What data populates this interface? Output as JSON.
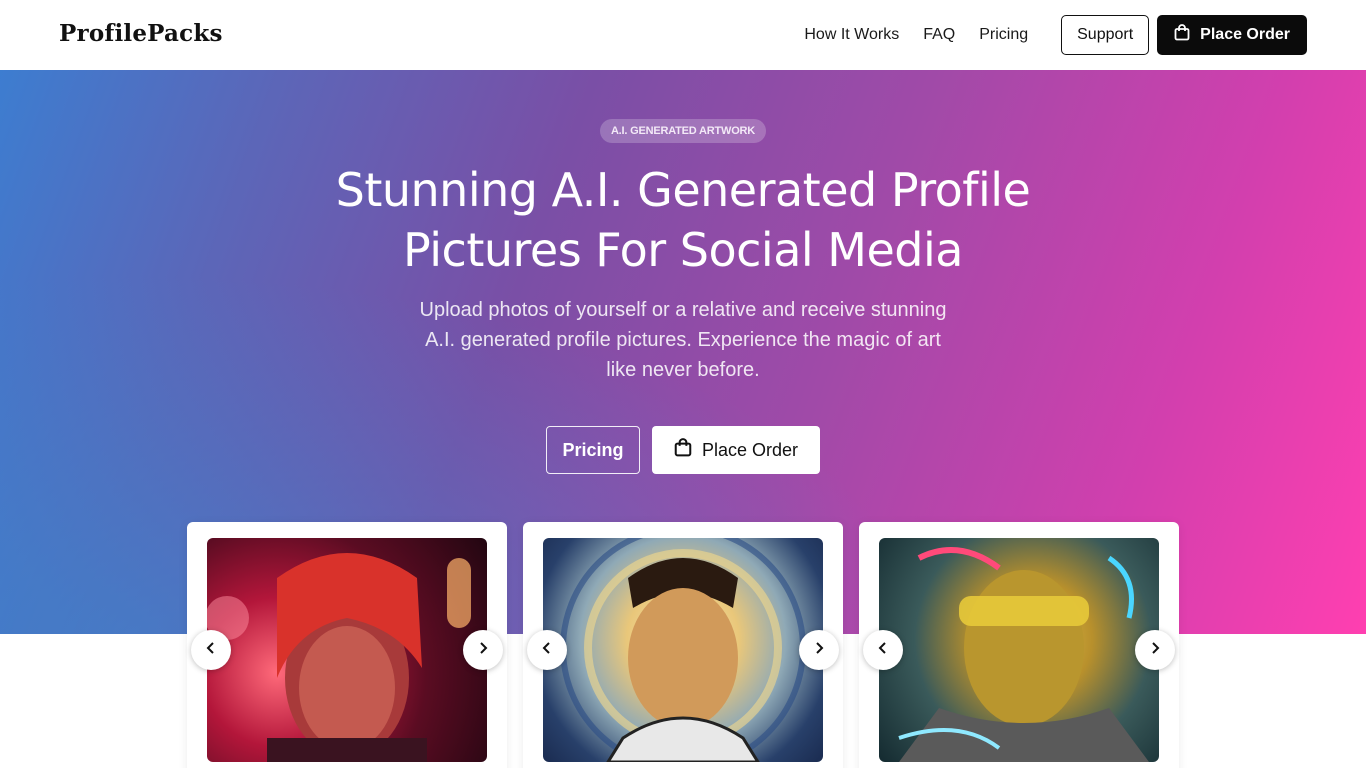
{
  "header": {
    "logo": "ProfilePacks",
    "nav": [
      "How It Works",
      "FAQ",
      "Pricing"
    ],
    "support_label": "Support",
    "order_label": "Place Order"
  },
  "hero": {
    "badge": "A.I. GENERATED ARTWORK",
    "title": "Stunning A.I. Generated Profile Pictures For Social Media",
    "subtitle": "Upload photos of yourself or a relative and receive stunning A.I. generated profile pictures. Experience the magic of art like never before.",
    "pricing_label": "Pricing",
    "order_label": "Place Order"
  },
  "gallery": {
    "cards": [
      {
        "image": "neon-red-portrait"
      },
      {
        "image": "astronaut-painting-portrait"
      },
      {
        "image": "golden-cyborg-portrait"
      }
    ]
  },
  "colors": {
    "accent_dark": "#0b0b0b",
    "gradient_start": "#3d7dd0",
    "gradient_end": "#ff3fb0"
  },
  "icons": {
    "bag": "shopping-bag-icon",
    "prev": "chevron-left-icon",
    "next": "chevron-right-icon"
  }
}
